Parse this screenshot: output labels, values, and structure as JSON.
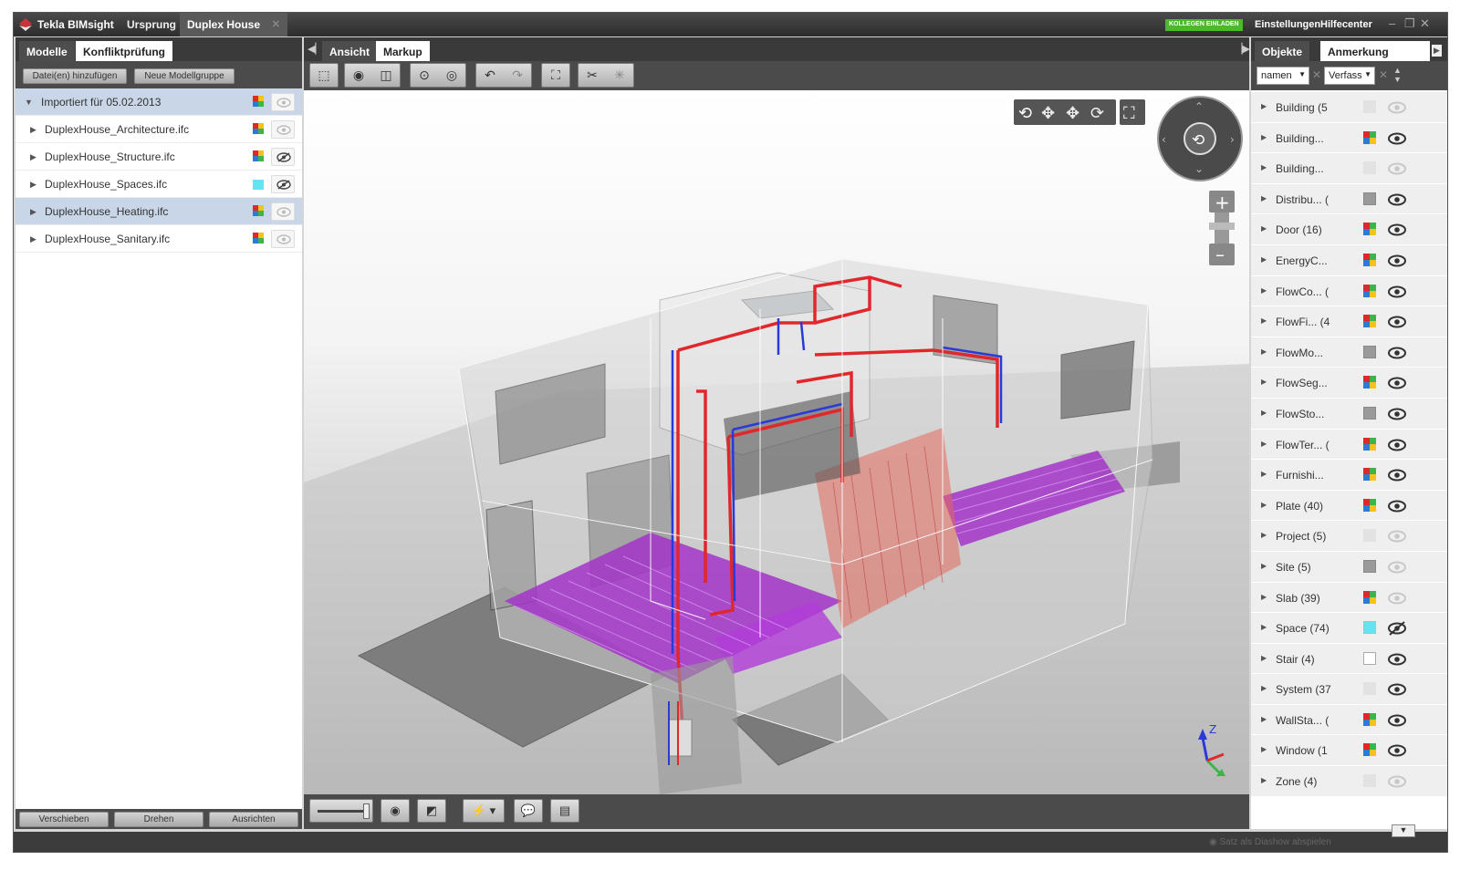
{
  "titlebar": {
    "app_name": "Tekla BIMsight",
    "crumb": "Ursprung",
    "document_tab": "Duplex House",
    "invite_label": "KOLLEGEN EINLADEN",
    "settings_label": "Einstellungen",
    "help_label": "Hilfecenter"
  },
  "left_panel": {
    "tabs": [
      "Modelle",
      "Konfliktprüfung"
    ],
    "add_files_label": "Datei(en) hinzufügen",
    "new_group_label": "Neue Modellgruppe",
    "group_label": "Importiert für 05.02.2013",
    "models": [
      {
        "name": "DuplexHouse_Architecture.ifc",
        "selected": false,
        "hidden": false
      },
      {
        "name": "DuplexHouse_Structure.ifc",
        "selected": false,
        "hidden": true
      },
      {
        "name": "DuplexHouse_Spaces.ifc",
        "selected": false,
        "hidden": true
      },
      {
        "name": "DuplexHouse_Heating.ifc",
        "selected": true,
        "hidden": false
      },
      {
        "name": "DuplexHouse_Sanitary.ifc",
        "selected": false,
        "hidden": false
      }
    ],
    "bottom_buttons": [
      "Verschieben",
      "Drehen",
      "Ausrichten"
    ]
  },
  "viewer": {
    "tabs": [
      "Ansicht",
      "Markup"
    ],
    "axis_label": "Z"
  },
  "right_panel": {
    "tabs": [
      "Objekte",
      "Anmerkung"
    ],
    "filter1": "namen",
    "filter2": "Verfass",
    "objects": [
      {
        "label": "Building (5",
        "swatch": "none",
        "eye": "faded"
      },
      {
        "label": "Building...",
        "swatch": "multi",
        "eye": "on"
      },
      {
        "label": "Building...",
        "swatch": "none",
        "eye": "faded"
      },
      {
        "label": "Distribu... (",
        "swatch": "grey",
        "eye": "on"
      },
      {
        "label": "Door (16)",
        "swatch": "multi",
        "eye": "on"
      },
      {
        "label": "EnergyC...",
        "swatch": "multi",
        "eye": "on"
      },
      {
        "label": "FlowCo... (",
        "swatch": "multi",
        "eye": "on"
      },
      {
        "label": "FlowFi... (4",
        "swatch": "multi",
        "eye": "on"
      },
      {
        "label": "FlowMo...",
        "swatch": "grey",
        "eye": "on"
      },
      {
        "label": "FlowSeg...",
        "swatch": "multi",
        "eye": "on"
      },
      {
        "label": "FlowSto...",
        "swatch": "grey",
        "eye": "on"
      },
      {
        "label": "FlowTer... (",
        "swatch": "multi",
        "eye": "on"
      },
      {
        "label": "Furnishi...",
        "swatch": "multi",
        "eye": "on"
      },
      {
        "label": "Plate (40)",
        "swatch": "multi",
        "eye": "on"
      },
      {
        "label": "Project (5)",
        "swatch": "none",
        "eye": "faded"
      },
      {
        "label": "Site (5)",
        "swatch": "grey",
        "eye": "faded"
      },
      {
        "label": "Slab (39)",
        "swatch": "multi",
        "eye": "faded"
      },
      {
        "label": "Space (74)",
        "swatch": "cyan",
        "eye": "hidden"
      },
      {
        "label": "Stair (4)",
        "swatch": "white",
        "eye": "on"
      },
      {
        "label": "System (37",
        "swatch": "none",
        "eye": "on"
      },
      {
        "label": "WallSta... (",
        "swatch": "multi",
        "eye": "on"
      },
      {
        "label": "Window (1",
        "swatch": "multi",
        "eye": "on"
      },
      {
        "label": "Zone (4)",
        "swatch": "none",
        "eye": "faded"
      }
    ]
  },
  "statusbar": {
    "slideshow_label": "Satz als Diashow abspielen"
  },
  "colors": {
    "accent_green": "#4db82b",
    "selection": "#c9d6e8",
    "floor_heating": "#a334c9",
    "pipe_red": "#e0282c",
    "pipe_blue": "#2a3ad6"
  }
}
